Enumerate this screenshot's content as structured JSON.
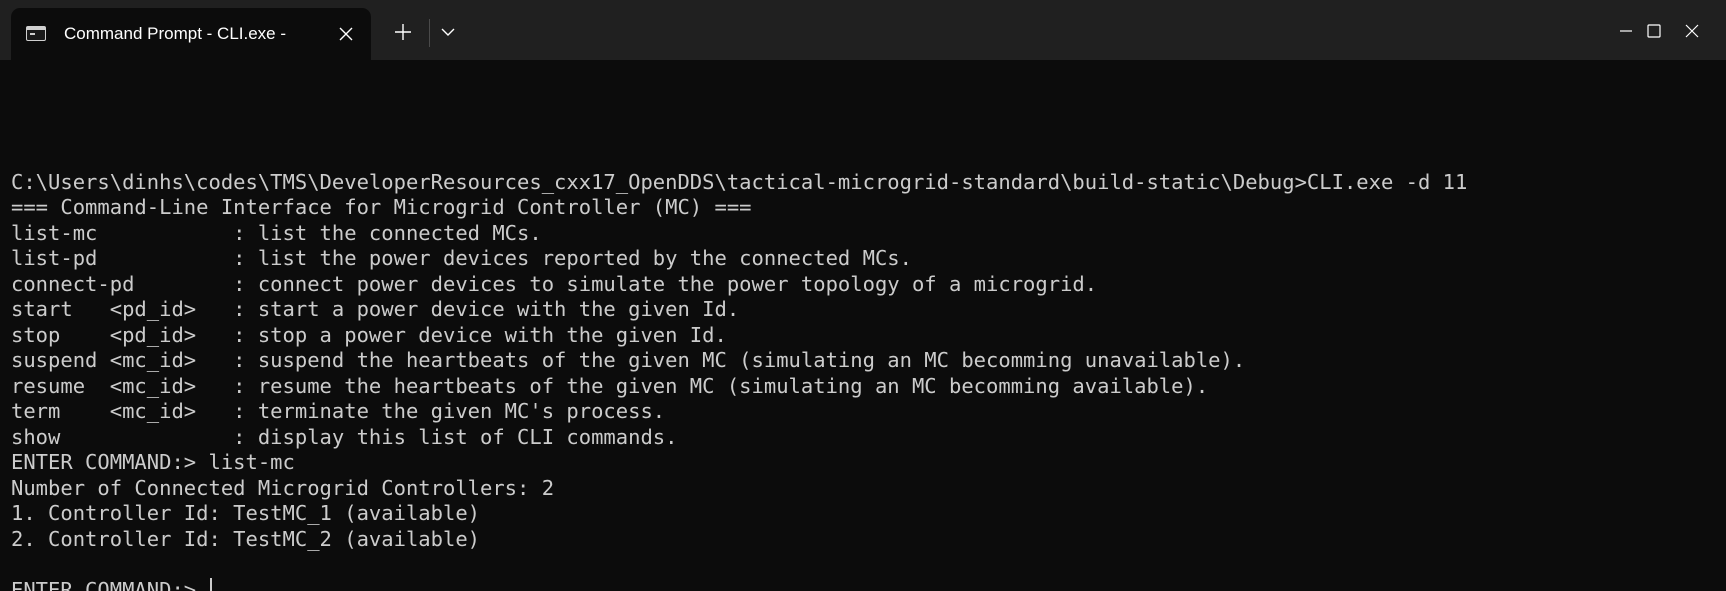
{
  "window": {
    "tab_title": "Command Prompt - CLI.exe -",
    "icons": {
      "tab": "terminal-icon",
      "close_tab": "close-icon",
      "new_tab": "plus-icon",
      "dropdown": "chevron-down-icon",
      "minimize": "minimize-icon",
      "maximize": "maximize-icon",
      "close_window": "close-icon"
    },
    "colors": {
      "titlebar": "#202020",
      "terminal_bg": "#0c0c0c",
      "text": "#cccccc"
    }
  },
  "terminal": {
    "lines": [
      "",
      "C:\\Users\\dinhs\\codes\\TMS\\DeveloperResources_cxx17_OpenDDS\\tactical-microgrid-standard\\build-static\\Debug>CLI.exe -d 11",
      "=== Command-Line Interface for Microgrid Controller (MC) ===",
      "list-mc           : list the connected MCs.",
      "list-pd           : list the power devices reported by the connected MCs.",
      "connect-pd        : connect power devices to simulate the power topology of a microgrid.",
      "start   <pd_id>   : start a power device with the given Id.",
      "stop    <pd_id>   : stop a power device with the given Id.",
      "suspend <mc_id>   : suspend the heartbeats of the given MC (simulating an MC becomming unavailable).",
      "resume  <mc_id>   : resume the heartbeats of the given MC (simulating an MC becomming available).",
      "term    <mc_id>   : terminate the given MC's process.",
      "show              : display this list of CLI commands.",
      "ENTER COMMAND:> list-mc",
      "Number of Connected Microgrid Controllers: 2",
      "1. Controller Id: TestMC_1 (available)",
      "2. Controller Id: TestMC_2 (available)",
      ""
    ],
    "prompt": "ENTER COMMAND:> "
  }
}
